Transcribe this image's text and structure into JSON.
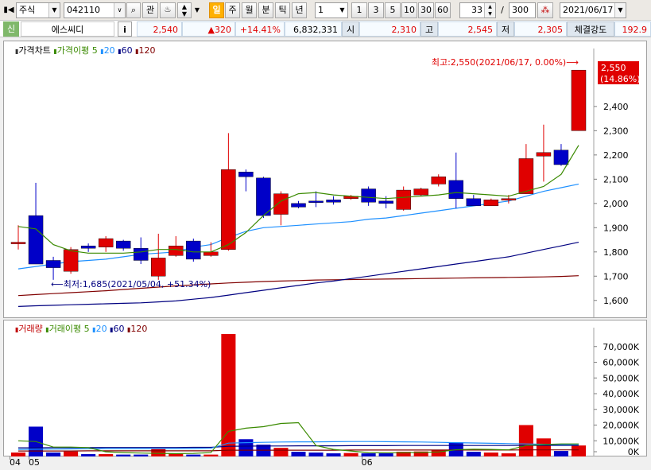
{
  "toolbar": {
    "market_select": "주식",
    "code_input": "042110",
    "search_icon": "magnifier-icon",
    "watch_label": "관",
    "type_tabs": [
      "일",
      "주",
      "월",
      "분",
      "틱",
      "년"
    ],
    "interval_value": "1",
    "quick_intervals": [
      "1",
      "3",
      "5",
      "10",
      "30",
      "60"
    ],
    "count_value": "33",
    "slash": "/",
    "total_value": "300",
    "date_value": "2021/06/17"
  },
  "infobar": {
    "badge": "신",
    "name": "에스씨디",
    "info_button": "i",
    "price": "2,540",
    "change": "▲320",
    "change_pct": "+14.41%",
    "volume": "6,832,331",
    "open_label": "시",
    "open_value": "2,310",
    "high_label": "고",
    "high_value": "2,545",
    "low_label": "저",
    "low_value": "2,305",
    "strength_label": "체결강도",
    "strength_value": "192.9"
  },
  "price_panel": {
    "legend": {
      "main": "가격차트",
      "ma_label": "가격이평",
      "ma": [
        "5",
        "20",
        "60",
        "120"
      ]
    },
    "max_annotation": "최고:2,550(2021/06/17, 0.00%)⟶",
    "min_annotation": "⟵최저:1,685(2021/05/04, +51.34%)",
    "current_price": "2,550",
    "current_pct": "(14.86%)",
    "y_ticks": [
      "2,400",
      "2,300",
      "2,200",
      "2,100",
      "2,000",
      "1,900",
      "1,800",
      "1,700",
      "1,600"
    ]
  },
  "volume_panel": {
    "legend": {
      "main": "거래량",
      "ma_label": "거래이평",
      "ma": [
        "5",
        "20",
        "60",
        "120"
      ]
    },
    "y_ticks": [
      "70,000K",
      "60,000K",
      "50,000K",
      "40,000K",
      "30,000K",
      "20,000K",
      "10,000K",
      "0K"
    ]
  },
  "x_axis": {
    "labels": [
      "04",
      "05",
      "06"
    ]
  },
  "colors": {
    "up": "#e00000",
    "down": "#0000c8",
    "ma5": "#3a8a00",
    "ma20": "#1e90ff",
    "ma60": "#000080",
    "ma120": "#800000"
  },
  "chart_data": {
    "type": "candlestick",
    "candles": [
      {
        "o": 1840,
        "h": 1910,
        "l": 1810,
        "c": 1840
      },
      {
        "o": 1950,
        "h": 2085,
        "l": 1750,
        "c": 1750
      },
      {
        "o": 1765,
        "h": 1780,
        "l": 1685,
        "c": 1735
      },
      {
        "o": 1720,
        "h": 1820,
        "l": 1710,
        "c": 1810
      },
      {
        "o": 1825,
        "h": 1835,
        "l": 1800,
        "c": 1815
      },
      {
        "o": 1820,
        "h": 1865,
        "l": 1800,
        "c": 1855
      },
      {
        "o": 1845,
        "h": 1850,
        "l": 1805,
        "c": 1815
      },
      {
        "o": 1815,
        "h": 1860,
        "l": 1750,
        "c": 1765
      },
      {
        "o": 1700,
        "h": 1875,
        "l": 1685,
        "c": 1775
      },
      {
        "o": 1785,
        "h": 1865,
        "l": 1780,
        "c": 1825
      },
      {
        "o": 1845,
        "h": 1855,
        "l": 1760,
        "c": 1770
      },
      {
        "o": 1785,
        "h": 1840,
        "l": 1780,
        "c": 1800
      },
      {
        "o": 1810,
        "h": 2290,
        "l": 1805,
        "c": 2140
      },
      {
        "o": 2130,
        "h": 2140,
        "l": 2050,
        "c": 2110
      },
      {
        "o": 2105,
        "h": 2110,
        "l": 1940,
        "c": 1950
      },
      {
        "o": 1955,
        "h": 2050,
        "l": 1910,
        "c": 2040
      },
      {
        "o": 2000,
        "h": 2010,
        "l": 1980,
        "c": 1985
      },
      {
        "o": 2010,
        "h": 2050,
        "l": 1985,
        "c": 2005
      },
      {
        "o": 2015,
        "h": 2030,
        "l": 1995,
        "c": 2005
      },
      {
        "o": 2020,
        "h": 2035,
        "l": 2015,
        "c": 2030
      },
      {
        "o": 2060,
        "h": 2070,
        "l": 1990,
        "c": 2005
      },
      {
        "o": 2010,
        "h": 2030,
        "l": 1980,
        "c": 2000
      },
      {
        "o": 1975,
        "h": 2070,
        "l": 1970,
        "c": 2055
      },
      {
        "o": 2035,
        "h": 2065,
        "l": 2030,
        "c": 2060
      },
      {
        "o": 2080,
        "h": 2120,
        "l": 2070,
        "c": 2110
      },
      {
        "o": 2095,
        "h": 2210,
        "l": 1980,
        "c": 2020
      },
      {
        "o": 2020,
        "h": 2035,
        "l": 1990,
        "c": 1990
      },
      {
        "o": 1990,
        "h": 2020,
        "l": 1990,
        "c": 2015
      },
      {
        "o": 2015,
        "h": 2035,
        "l": 2000,
        "c": 2020
      },
      {
        "o": 2040,
        "h": 2245,
        "l": 2040,
        "c": 2185
      },
      {
        "o": 2195,
        "h": 2325,
        "l": 2090,
        "c": 2210
      },
      {
        "o": 2220,
        "h": 2245,
        "l": 2155,
        "c": 2160
      },
      {
        "o": 2300,
        "h": 2550,
        "l": 2300,
        "c": 2550
      }
    ],
    "ma5": [
      1905,
      1895,
      1830,
      1805,
      1795,
      1795,
      1795,
      1800,
      1810,
      1810,
      1800,
      1800,
      1830,
      1880,
      1950,
      2010,
      2040,
      2045,
      2035,
      2030,
      2025,
      2020,
      2025,
      2030,
      2035,
      2045,
      2040,
      2035,
      2030,
      2050,
      2070,
      2120,
      2240
    ],
    "ma20": [
      1730,
      1740,
      1750,
      1760,
      1765,
      1770,
      1780,
      1790,
      1795,
      1800,
      1820,
      1830,
      1860,
      1885,
      1900,
      1905,
      1910,
      1915,
      1920,
      1925,
      1935,
      1940,
      1950,
      1960,
      1970,
      1980,
      1990,
      2000,
      2010,
      2030,
      2050,
      2065,
      2080
    ],
    "ma60": [
      1575,
      1578,
      1580,
      1582,
      1584,
      1586,
      1588,
      1590,
      1594,
      1598,
      1605,
      1612,
      1622,
      1632,
      1642,
      1652,
      1662,
      1672,
      1680,
      1690,
      1700,
      1710,
      1720,
      1730,
      1740,
      1750,
      1760,
      1770,
      1780,
      1795,
      1810,
      1825,
      1840
    ],
    "ma120": [
      1620,
      1624,
      1628,
      1632,
      1636,
      1640,
      1645,
      1650,
      1655,
      1660,
      1664,
      1668,
      1672,
      1675,
      1678,
      1680,
      1682,
      1684,
      1685,
      1686,
      1687,
      1688,
      1689,
      1690,
      1691,
      1692,
      1693,
      1694,
      1695,
      1696,
      1697,
      1699,
      1702
    ],
    "volume_k": [
      2500,
      19000,
      2500,
      3200,
      1500,
      1500,
      1200,
      1200,
      5000,
      2000,
      1200,
      1200,
      78000,
      11000,
      7500,
      5500,
      3000,
      2500,
      2000,
      2200,
      2000,
      2000,
      3000,
      3200,
      4000,
      9000,
      3000,
      2500,
      2000,
      20000,
      11500,
      3500,
      7000
    ],
    "volume_up": [
      true,
      false,
      false,
      true,
      false,
      true,
      false,
      false,
      true,
      true,
      false,
      true,
      true,
      false,
      false,
      true,
      false,
      false,
      false,
      true,
      false,
      false,
      true,
      true,
      true,
      false,
      false,
      true,
      true,
      true,
      true,
      false,
      true
    ],
    "vol_ma5": [
      10000,
      9500,
      6000,
      6000,
      5600,
      3000,
      2500,
      2200,
      2000,
      1800,
      2000,
      2500,
      16000,
      18000,
      19000,
      21000,
      21500,
      7000,
      4500,
      3500,
      2500,
      2400,
      2400,
      2600,
      2900,
      4300,
      4600,
      4500,
      4200,
      7000,
      7600,
      8000,
      8000
    ],
    "vol_ma20": [
      4500,
      4600,
      4700,
      4800,
      4900,
      5000,
      5000,
      5000,
      5000,
      5000,
      5000,
      5200,
      8500,
      8800,
      9000,
      9200,
      9300,
      9300,
      9400,
      9500,
      9500,
      9400,
      9300,
      9200,
      9000,
      8800,
      8600,
      8400,
      8200,
      8000,
      7800,
      7600,
      7500
    ],
    "vol_ma60": [
      5500,
      5500,
      5600,
      5600,
      5600,
      5700,
      5700,
      5700,
      5700,
      5700,
      5800,
      5800,
      6500,
      6600,
      6700,
      6700,
      6800,
      6800,
      6800,
      6900,
      6900,
      6900,
      7000,
      7000,
      7000,
      7000,
      7000,
      7000,
      7000,
      7100,
      7100,
      7100,
      7100
    ],
    "vol_ma120": [
      3500,
      3500,
      3500,
      3500,
      3600,
      3600,
      3600,
      3600,
      3600,
      3600,
      3600,
      3600,
      4000,
      4000,
      4000,
      4000,
      4000,
      4000,
      4000,
      4100,
      4100,
      4100,
      4100,
      4100,
      4100,
      4100,
      4100,
      4100,
      4100,
      4200,
      4200,
      4200,
      4200
    ],
    "price_ylim": [
      1550,
      2580
    ],
    "volume_ylim": [
      0,
      80000
    ]
  }
}
